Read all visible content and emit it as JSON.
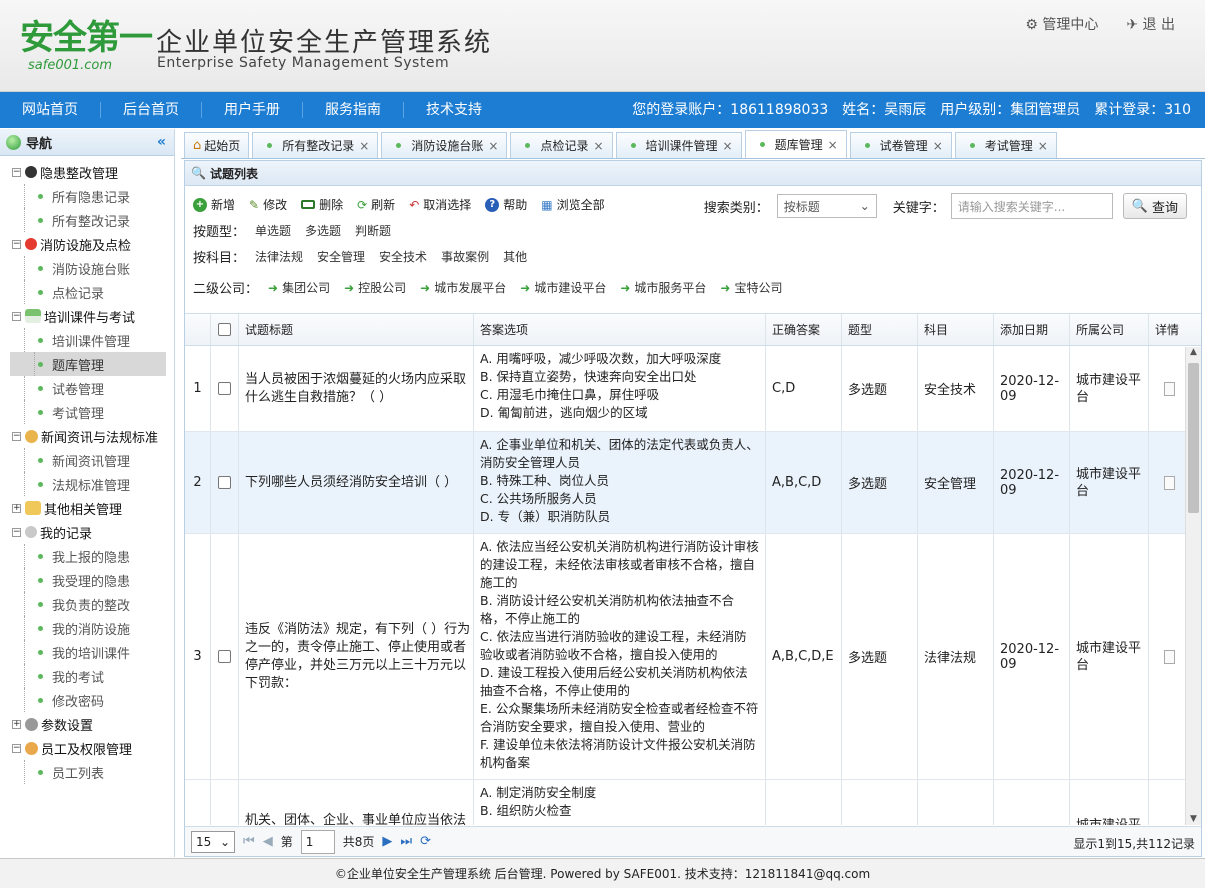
{
  "header": {
    "logo_main": "安全第一",
    "logo_sub": "safe001.com",
    "title": "企业单位安全生产管理系统",
    "title_en": "Enterprise Safety Management System",
    "admin_center": "管理中心",
    "logout": "退 出"
  },
  "nav": {
    "links": [
      "网站首页",
      "后台首页",
      "用户手册",
      "服务指南",
      "技术支持"
    ],
    "account": "您的登录账户：18611898033",
    "name": "姓名：吴雨辰",
    "level": "用户级别：集团管理员",
    "logins": "累计登录：310"
  },
  "sidebar": {
    "title": "导航",
    "collapse": "«",
    "groups": [
      {
        "label": "隐患整改管理",
        "items": [
          "所有隐患记录",
          "所有整改记录"
        ]
      },
      {
        "label": "消防设施及点检",
        "items": [
          "消防设施台账",
          "点检记录"
        ]
      },
      {
        "label": "培训课件与考试",
        "items": [
          "培训课件管理",
          "题库管理",
          "试卷管理",
          "考试管理"
        ]
      },
      {
        "label": "新闻资讯与法规标准",
        "items": [
          "新闻资讯管理",
          "法规标准管理"
        ]
      },
      {
        "label": "其他相关管理",
        "items": []
      },
      {
        "label": "我的记录",
        "items": [
          "我上报的隐患",
          "我受理的隐患",
          "我负责的整改",
          "我的消防设施",
          "我的培训课件",
          "我的考试",
          "修改密码"
        ]
      },
      {
        "label": "参数设置",
        "items": []
      },
      {
        "label": "员工及权限管理",
        "items": [
          "员工列表"
        ]
      }
    ]
  },
  "tabs": [
    "起始页",
    "所有整改记录",
    "消防设施台账",
    "点检记录",
    "培训课件管理",
    "题库管理",
    "试卷管理",
    "考试管理"
  ],
  "panel": {
    "title": "试题列表"
  },
  "toolbar": {
    "add": "新增",
    "edit": "修改",
    "delete": "删除",
    "refresh": "刷新",
    "deselect": "取消选择",
    "help": "帮助",
    "browse_all": "浏览全部"
  },
  "search": {
    "type_label": "搜索类别：",
    "type_value": "按标题",
    "keyword_label": "关键字：",
    "keyword_placeholder": "请输入搜索关键字...",
    "button": "查询"
  },
  "filters": {
    "type_label": "按题型：",
    "types": [
      "单选题",
      "多选题",
      "判断题"
    ],
    "subject_label": "按科目：",
    "subjects": [
      "法律法规",
      "安全管理",
      "安全技术",
      "事故案例",
      "其他"
    ],
    "company_label": "二级公司：",
    "companies": [
      "集团公司",
      "控股公司",
      "城市发展平台",
      "城市建设平台",
      "城市服务平台",
      "宝特公司"
    ]
  },
  "grid": {
    "headers": [
      "试题标题",
      "答案选项",
      "正确答案",
      "题型",
      "科目",
      "添加日期",
      "所属公司",
      "详情"
    ],
    "rows": [
      {
        "num": "1",
        "title": "当人员被困于浓烟蔓延的火场内应采取什么逃生自救措施？（  ）",
        "options": [
          "A. 用嘴呼吸，减少呼吸次数，加大呼吸深度",
          "B. 保持直立姿势，快速奔向安全出口处",
          "C. 用湿毛巾掩住口鼻，屏住呼吸",
          "D. 匍匐前进，逃向烟少的区域"
        ],
        "answer": "C,D",
        "type": "多选题",
        "subject": "安全技术",
        "date": "2020-12-09",
        "company": "城市建设平台"
      },
      {
        "num": "2",
        "title": "下列哪些人员须经消防安全培训（  ）",
        "options": [
          "A. 企事业单位和机关、团体的法定代表或负责人、消防安全管理人员",
          "B. 特殊工种、岗位人员",
          "C. 公共场所服务人员",
          "D. 专（兼）职消防队员"
        ],
        "answer": "A,B,C,D",
        "type": "多选题",
        "subject": "安全管理",
        "date": "2020-12-09",
        "company": "城市建设平台"
      },
      {
        "num": "3",
        "title": "违反《消防法》规定，有下列（  ）行为之一的，责令停止施工、停止使用或者停产停业，并处三万元以上三十万元以下罚款：",
        "options": [
          "A. 依法应当经公安机关消防机构进行消防设计审核的建设工程，未经依法审核或者审核不合格，擅自施工的",
          "B. 消防设计经公安机关消防机构依法抽查不合格，不停止施工的",
          "C. 依法应当进行消防验收的建设工程，未经消防验收或者消防验收不合格，擅自投入使用的",
          "D. 建设工程投入使用后经公安机关消防机构依法抽查不合格，不停止使用的",
          "E. 公众聚集场所未经消防安全检查或者经检查不符合消防安全要求，擅自投入使用、营业的",
          "F. 建设单位未依法将消防设计文件报公安机关消防机构备案"
        ],
        "answer": "A,B,C,D,E",
        "type": "多选题",
        "subject": "法律法规",
        "date": "2020-12-09",
        "company": "城市建设平台"
      },
      {
        "num": "4",
        "title": "机关、团体、企业、事业单位应当依法",
        "options": [
          "A. 制定消防安全制度",
          "B. 组织防火检查"
        ],
        "answer": "",
        "type": "",
        "subject": "",
        "date": "",
        "company": "城市建设平"
      }
    ]
  },
  "pager": {
    "page_size": "15",
    "page_label": "第",
    "page": "1",
    "total_pages": "共8页",
    "summary": "显示1到15,共112记录"
  },
  "footer": "©企业单位安全生产管理系统 后台管理. Powered by SAFE001.   技术支持：121811841@qq.com"
}
